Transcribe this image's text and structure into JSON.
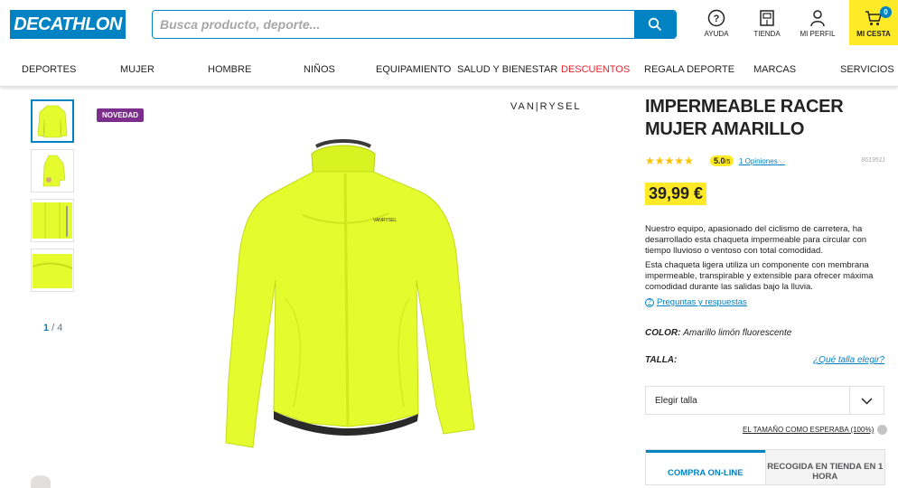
{
  "header": {
    "logo": "DECATHLON",
    "search_placeholder": "Busca producto, deporte...",
    "help_label": "AYUDA",
    "store_label": "TIENDA",
    "profile_label": "MI PERFIL",
    "cart_label": "MI CESTA",
    "cart_count": "0"
  },
  "nav": {
    "items": [
      "DEPORTES",
      "MUJER",
      "HOMBRE",
      "NIÑOS",
      "EQUIPAMIENTO",
      "SALUD Y BIENESTAR",
      "DESCUENTOS",
      "REGALA DEPORTE",
      "MARCAS",
      "SERVICIOS"
    ],
    "promo_color": "#e3262f"
  },
  "gallery": {
    "badge": "NOVEDAD",
    "brand": "VAN|RYSEL",
    "page_current": "1",
    "page_sep": " / ",
    "page_total": "4"
  },
  "product": {
    "title": "IMPERMEABLE RACER MUJER AMARILLO",
    "rating": "5.0",
    "rating_max": "/5",
    "opinions": "1 Opiniones",
    "reference": "8619511",
    "price": "39,99 €",
    "description_1": "Nuestro equipo, apasionado del ciclismo de carretera, ha desarrollado esta chaqueta impermeable para circular con tiempo lluvioso o ventoso con total comodidad.",
    "description_2": "Esta chaqueta ligera utiliza un componente con membrana impermeable, transpirable y extensible para ofrecer máxima comodidad durante las salidas bajo la lluvia.",
    "faq_link": "Preguntas y respuestas",
    "color_label": "COLOR:",
    "color_value": "Amarillo limón fluorescente",
    "size_label": "TALLA:",
    "size_guide": "¿Qué talla elegir?",
    "size_select": "Elegir talla",
    "fit_text": "EL TAMAÑO COMO ESPERABA (100%)",
    "tab_online": "COMPRA ON-LINE",
    "tab_store": "RECOGIDA EN TIENDA EN 1 HORA"
  },
  "colors": {
    "brand_blue": "#0082c3",
    "yellow": "#ffea28",
    "novedad": "#7b2e8c",
    "jacket": "#e4fb2e"
  }
}
